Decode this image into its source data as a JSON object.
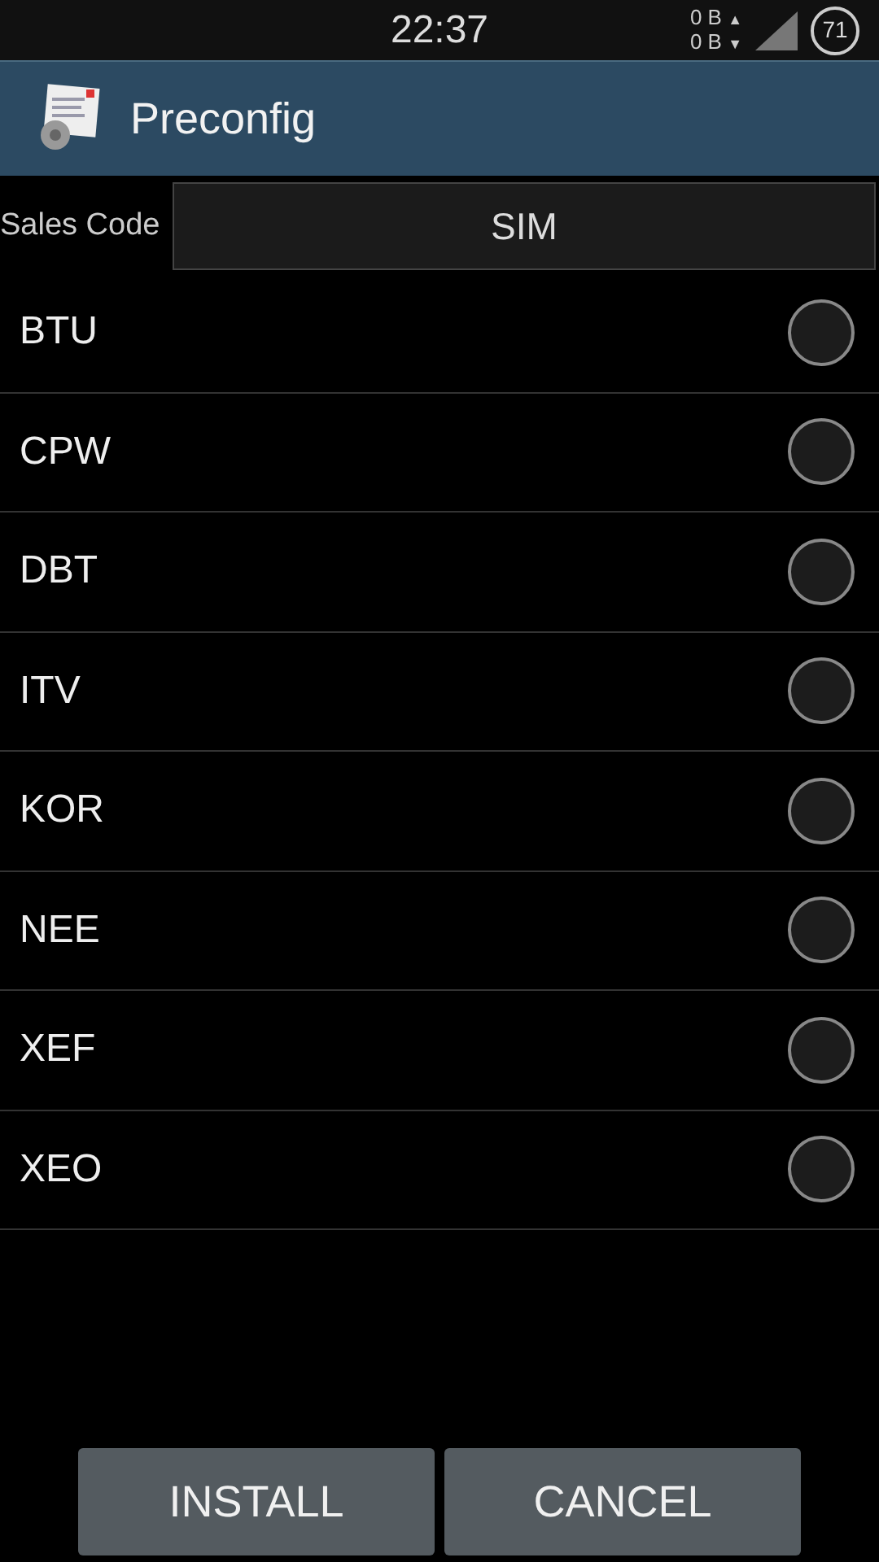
{
  "status_bar": {
    "time": "22:37",
    "upload": "0 B",
    "upload_arrow": "▲",
    "download": "0 B",
    "download_arrow": "▼",
    "battery": "71"
  },
  "app_bar": {
    "title": "Preconfig"
  },
  "sales_code": {
    "label": "Sales Code",
    "value": "SIM"
  },
  "options": [
    {
      "label": "BTU",
      "selected": false
    },
    {
      "label": "CPW",
      "selected": false
    },
    {
      "label": "DBT",
      "selected": false
    },
    {
      "label": "ITV",
      "selected": false
    },
    {
      "label": "KOR",
      "selected": false
    },
    {
      "label": "NEE",
      "selected": false
    },
    {
      "label": "XEF",
      "selected": false
    },
    {
      "label": "XEO",
      "selected": false
    }
  ],
  "buttons": [
    "INSTALL",
    "CANCEL"
  ]
}
